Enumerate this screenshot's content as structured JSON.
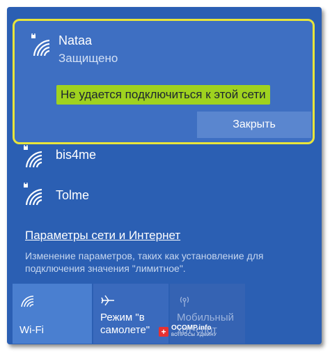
{
  "colors": {
    "panel": "#2b5fb3",
    "selected_bg": "#3e6fc2",
    "highlight_border": "#e8e53a",
    "error_highlight": "#9fd21f",
    "button": "#5a86cf",
    "tile_active": "#4a7fd0",
    "tile_inactive": "#3a6abd",
    "tile_disabled": "#3563b3"
  },
  "selected_network": {
    "name": "Nataa",
    "status": "Защищено",
    "error": "Не удается подключиться к этой сети",
    "close_label": "Закрыть",
    "icon": "secured-wifi-icon"
  },
  "networks": [
    {
      "name": "bis4me",
      "icon": "secured-wifi-icon"
    },
    {
      "name": "Tolme",
      "icon": "secured-wifi-icon"
    }
  ],
  "settings": {
    "link": "Параметры сети и Интернет",
    "description": "Изменение параметров, таких как установление для подключения значения \"лимитное\"."
  },
  "quick_actions": [
    {
      "label": "Wi-Fi",
      "icon": "wifi-icon",
      "state": "on"
    },
    {
      "label": "Режим \"в самолете\"",
      "icon": "airplane-icon",
      "state": "off"
    },
    {
      "label": "Мобильный хот-спот",
      "icon": "hotspot-icon",
      "state": "disabled"
    }
  ],
  "watermark": {
    "badge": "+",
    "text": "OCOMP.info",
    "subtext": "ВОПРОСЫ АДМИНУ"
  }
}
